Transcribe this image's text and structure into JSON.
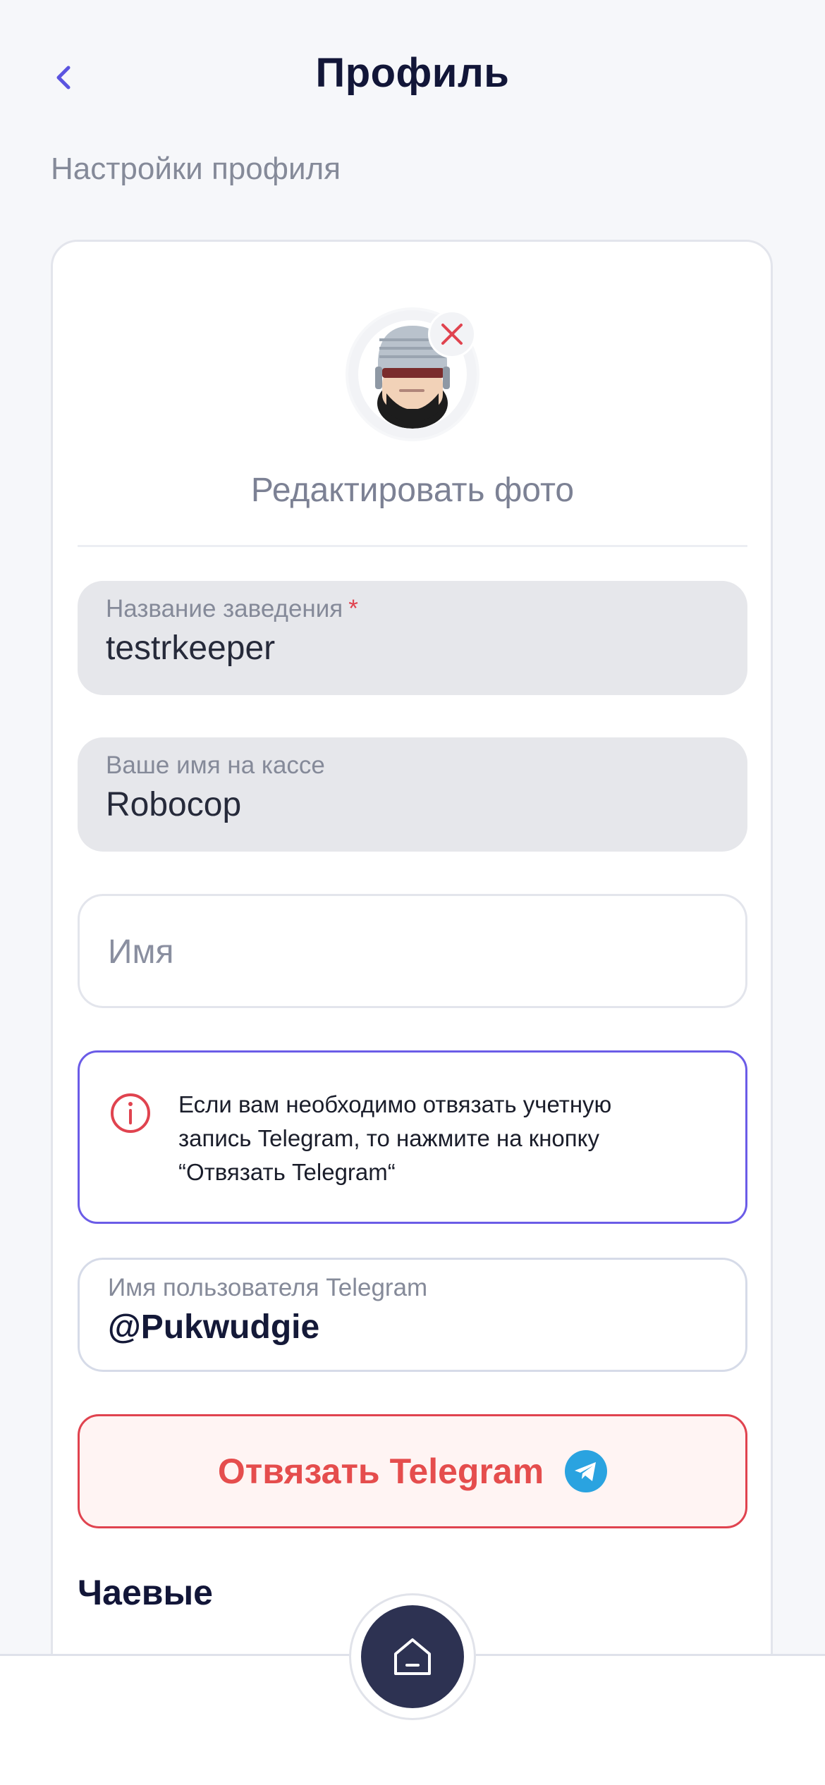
{
  "header": {
    "title": "Профиль"
  },
  "section_caption": "Настройки профиля",
  "photo": {
    "edit_label": "Редактировать фото"
  },
  "fields": {
    "venue": {
      "label": "Название заведения",
      "required_mark": "*",
      "value": "testrkeeper"
    },
    "cashier_name": {
      "label": "Ваше имя на кассе",
      "value": "Robocop"
    },
    "name": {
      "placeholder": "Имя"
    },
    "telegram": {
      "label": "Имя пользователя Telegram",
      "value": "@Pukwudgie"
    }
  },
  "notice": {
    "line1": "Если вам необходимо отвязать учетную",
    "line2": "запись Telegram, то нажмите на кнопку",
    "line3": "“Отвязать Telegram“"
  },
  "unlink_button": {
    "label": "Отвязать Telegram"
  },
  "tips": {
    "title": "Чаевые"
  },
  "colors": {
    "accent": "#6b5ce7",
    "danger": "#e0434f",
    "home_button": "#2d3252",
    "telegram": "#2aa3e0"
  },
  "icons": [
    "chevron-left-icon",
    "close-icon",
    "info-icon",
    "telegram-icon",
    "home-icon"
  ]
}
